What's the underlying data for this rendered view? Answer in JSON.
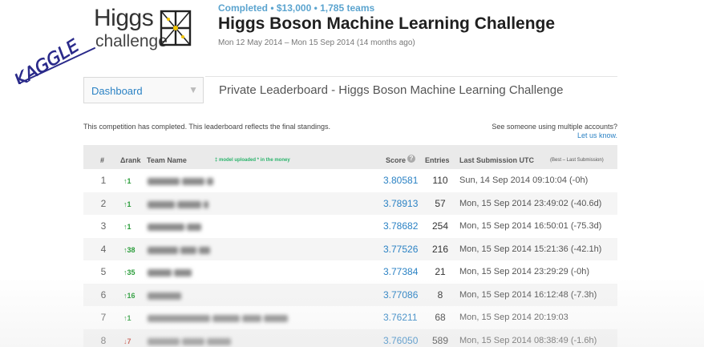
{
  "annotation": {
    "text": "KAGGLE"
  },
  "logo": {
    "word1": "Higgs",
    "word2": "challenge"
  },
  "header": {
    "status": "Completed • $13,000 • 1,785 teams",
    "title": "Higgs Boson Machine Learning Challenge",
    "dates": "Mon 12 May 2014 – Mon 15 Sep 2014 (14 months ago)"
  },
  "nav": {
    "dashboard_label": "Dashboard",
    "arrow": "▼"
  },
  "page": {
    "heading": "Private Leaderboard - Higgs Boson Machine Learning Challenge"
  },
  "notice": "This competition has completed. This leaderboard reflects the final standings.",
  "multiple_accounts": {
    "question": "See someone using multiple accounts?",
    "link": "Let us know."
  },
  "leaderboard": {
    "columns": {
      "rank": "#",
      "delta": "Δrank",
      "team": "Team Name",
      "team_note": "‡ model uploaded * in the money",
      "score": "Score",
      "score_help": "?",
      "entries": "Entries",
      "last": "Last Submission UTC",
      "last_note": "(Best – Last Submission)"
    },
    "rows": [
      {
        "rank": "1",
        "delta": "↑1",
        "dir": "up",
        "score": "3.80581",
        "entries": "110",
        "last": "Sun, 14 Sep 2014 09:10:04 (-0h)"
      },
      {
        "rank": "2",
        "delta": "↑1",
        "dir": "up",
        "score": "3.78913",
        "entries": "57",
        "last": "Mon, 15 Sep 2014 23:49:02 (-40.6d)"
      },
      {
        "rank": "3",
        "delta": "↑1",
        "dir": "up",
        "score": "3.78682",
        "entries": "254",
        "last": "Mon, 15 Sep 2014 16:50:01 (-75.3d)"
      },
      {
        "rank": "4",
        "delta": "↑38",
        "dir": "up",
        "score": "3.77526",
        "entries": "216",
        "last": "Mon, 15 Sep 2014 15:21:36 (-42.1h)"
      },
      {
        "rank": "5",
        "delta": "↑35",
        "dir": "up",
        "score": "3.77384",
        "entries": "21",
        "last": "Mon, 15 Sep 2014 23:29:29 (-0h)"
      },
      {
        "rank": "6",
        "delta": "↑16",
        "dir": "up",
        "score": "3.77086",
        "entries": "8",
        "last": "Mon, 15 Sep 2014 16:12:48 (-7.3h)"
      },
      {
        "rank": "7",
        "delta": "↑1",
        "dir": "up",
        "score": "3.76211",
        "entries": "68",
        "last": "Mon, 15 Sep 2014 20:19:03"
      },
      {
        "rank": "8",
        "delta": "↓7",
        "dir": "down",
        "score": "3.76050",
        "entries": "589",
        "last": "Mon, 15 Sep 2014 08:38:49 (-1.6h)"
      }
    ]
  },
  "colors": {
    "accent": "#2b82c4",
    "up": "#2a9d3a",
    "down": "#c0392b",
    "ink": "#2a2a8a"
  }
}
